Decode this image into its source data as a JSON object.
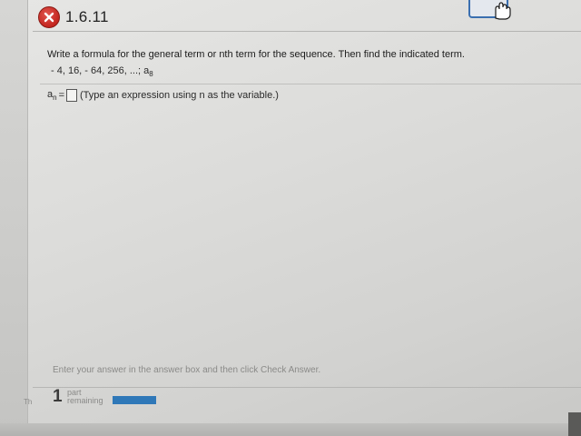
{
  "header": {
    "question_number": "1.6.11",
    "status_icon": "x-mark-icon",
    "status_color": "#c4261f"
  },
  "question": {
    "instruction": "Write a formula for the general term or nth term for the sequence. Then find the indicated term.",
    "sequence": "- 4, 16, - 64, 256, ...; a",
    "target_subscript": "8"
  },
  "answer": {
    "label": "a",
    "label_subscript": "n",
    "equals": "=",
    "value": "",
    "hint": "(Type an expression using n as the variable.)"
  },
  "footer": {
    "instruction": "Enter your answer in the answer box and then click Check Answer.",
    "parts_count": "1",
    "parts_label_line1": "part",
    "parts_label_line2": "remaining",
    "progress_fraction": 1.0,
    "progress_color": "#2f78b8",
    "gutter_label": "Th"
  }
}
